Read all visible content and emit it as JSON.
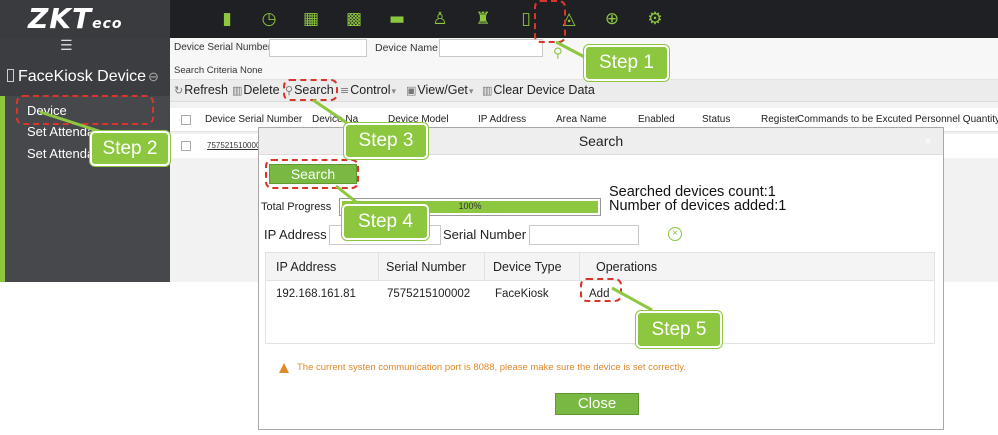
{
  "brand": {
    "logo": "ZKT",
    "logo_suffix": "eco"
  },
  "top_menu": [
    "Home",
    "Attendance",
    "Reports",
    "Access Control",
    "Elevator",
    "Consumption",
    "Visitor",
    "Device",
    "Patrol",
    "Security",
    "Settings"
  ],
  "sidebar": {
    "module_title": "FaceKiosk Device",
    "items": [
      {
        "label": "Device"
      },
      {
        "label": "Set Attenda"
      },
      {
        "label": "Set Attenda"
      }
    ]
  },
  "criteria": {
    "serial_label": "Device Serial Number",
    "name_label": "Device Name",
    "summary": "Search Criteria None"
  },
  "toolbar": {
    "refresh": "Refresh",
    "delete": "Delete",
    "search": "Search",
    "control": "Control",
    "view_get": "View/Get",
    "clear": "Clear Device Data"
  },
  "grid": {
    "columns": [
      "Device Serial Number",
      "Device Na",
      "Device Model",
      "IP Address",
      "Area Name",
      "Enabled",
      "Status",
      "Register",
      "Commands to be Excuted",
      "Personnel Quantity"
    ],
    "row_serial": "757521510000"
  },
  "dialog": {
    "title": "Search",
    "close_icon": "×",
    "search_button": "Search",
    "progress_label": "Total Progress",
    "progress_text": "100%",
    "progress_value": 1.0,
    "searched_count": "Searched devices count:1",
    "added_count": "Number of devices added:1",
    "ip_label": "IP Address",
    "serial_label": "Serial Number",
    "table": {
      "headers": [
        "IP Address",
        "Serial Number",
        "Device Type",
        "Operations"
      ],
      "rows": [
        {
          "ip": "192.168.161.81",
          "serial": "7575215100002",
          "type": "FaceKiosk",
          "operation": "Add"
        }
      ]
    },
    "warning": "The current systen communication port is 8088, please make sure the device is set correctly.",
    "close_button": "Close"
  },
  "steps": [
    "Step 1",
    "Step 2",
    "Step 3",
    "Step 4",
    "Step 5"
  ],
  "colors": {
    "accent": "#8dc63f",
    "annotation": "#d9362b",
    "warning": "#e0892b",
    "topbar": "#1f2024"
  }
}
